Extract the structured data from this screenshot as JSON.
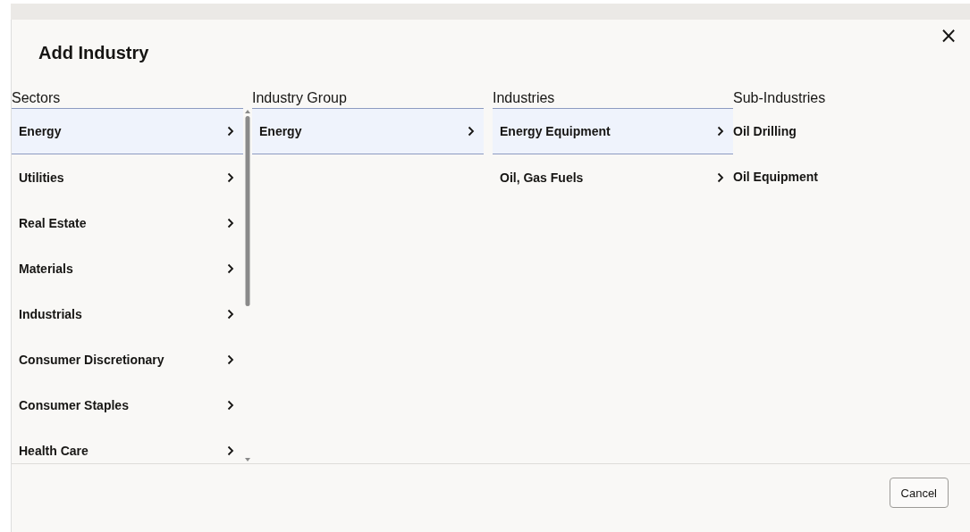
{
  "dialog": {
    "title": "Add Industry",
    "close_label": "×"
  },
  "columns": [
    {
      "heading": "Sectors",
      "scrollable": true,
      "items": [
        {
          "label": "Energy",
          "selected": true,
          "expandable": true
        },
        {
          "label": "Utilities",
          "selected": false,
          "expandable": true
        },
        {
          "label": "Real Estate",
          "selected": false,
          "expandable": true
        },
        {
          "label": "Materials",
          "selected": false,
          "expandable": true
        },
        {
          "label": "Industrials",
          "selected": false,
          "expandable": true
        },
        {
          "label": "Consumer Discretionary",
          "selected": false,
          "expandable": true
        },
        {
          "label": "Consumer Staples",
          "selected": false,
          "expandable": true
        },
        {
          "label": "Health Care",
          "selected": false,
          "expandable": true
        }
      ]
    },
    {
      "heading": "Industry Group",
      "scrollable": false,
      "items": [
        {
          "label": "Energy",
          "selected": true,
          "expandable": true
        }
      ]
    },
    {
      "heading": "Industries",
      "scrollable": false,
      "items": [
        {
          "label": "Energy Equipment",
          "selected": true,
          "expandable": true
        },
        {
          "label": "Oil, Gas Fuels",
          "selected": false,
          "expandable": true
        }
      ]
    },
    {
      "heading": "Sub-Industries",
      "scrollable": false,
      "items": [
        {
          "label": "Oil Drilling",
          "selected": false,
          "expandable": false
        },
        {
          "label": "Oil Equipment",
          "selected": false,
          "expandable": false
        }
      ]
    }
  ],
  "buttons": [
    {
      "label": "Cancel"
    }
  ]
}
